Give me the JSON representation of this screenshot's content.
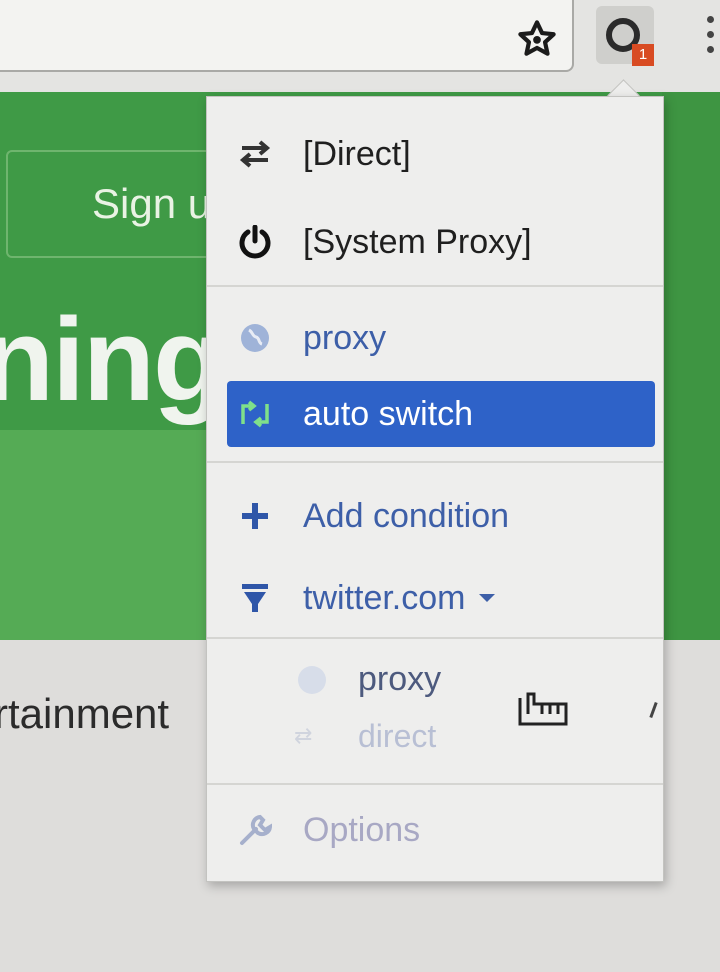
{
  "toolbar": {
    "star_icon": "star-icon",
    "extension_icon": "switchyomega-icon",
    "extension_badge": "1",
    "menu_icon": "vertical-dots-icon"
  },
  "page": {
    "signup_label": "Sign u",
    "hero_text": "ning",
    "category_text": "rtainment"
  },
  "popup": {
    "items": [
      {
        "label": "[Direct]",
        "icon": "swap-arrows-icon"
      },
      {
        "label": "[System Proxy]",
        "icon": "power-icon"
      },
      {
        "label": "proxy",
        "icon": "globe-icon"
      },
      {
        "label": "auto switch",
        "icon": "auto-switch-icon",
        "active": true
      },
      {
        "label": "Add condition",
        "icon": "plus-icon"
      },
      {
        "label": "twitter.com",
        "icon": "filter-icon"
      },
      {
        "label": "Options",
        "icon": "wrench-icon"
      }
    ],
    "submenu": {
      "proxy_label": "proxy",
      "direct_label": "direct"
    }
  },
  "colors": {
    "active_bg": "#2e62c8",
    "page_green": "#3f9a46",
    "badge": "#d84b22"
  }
}
